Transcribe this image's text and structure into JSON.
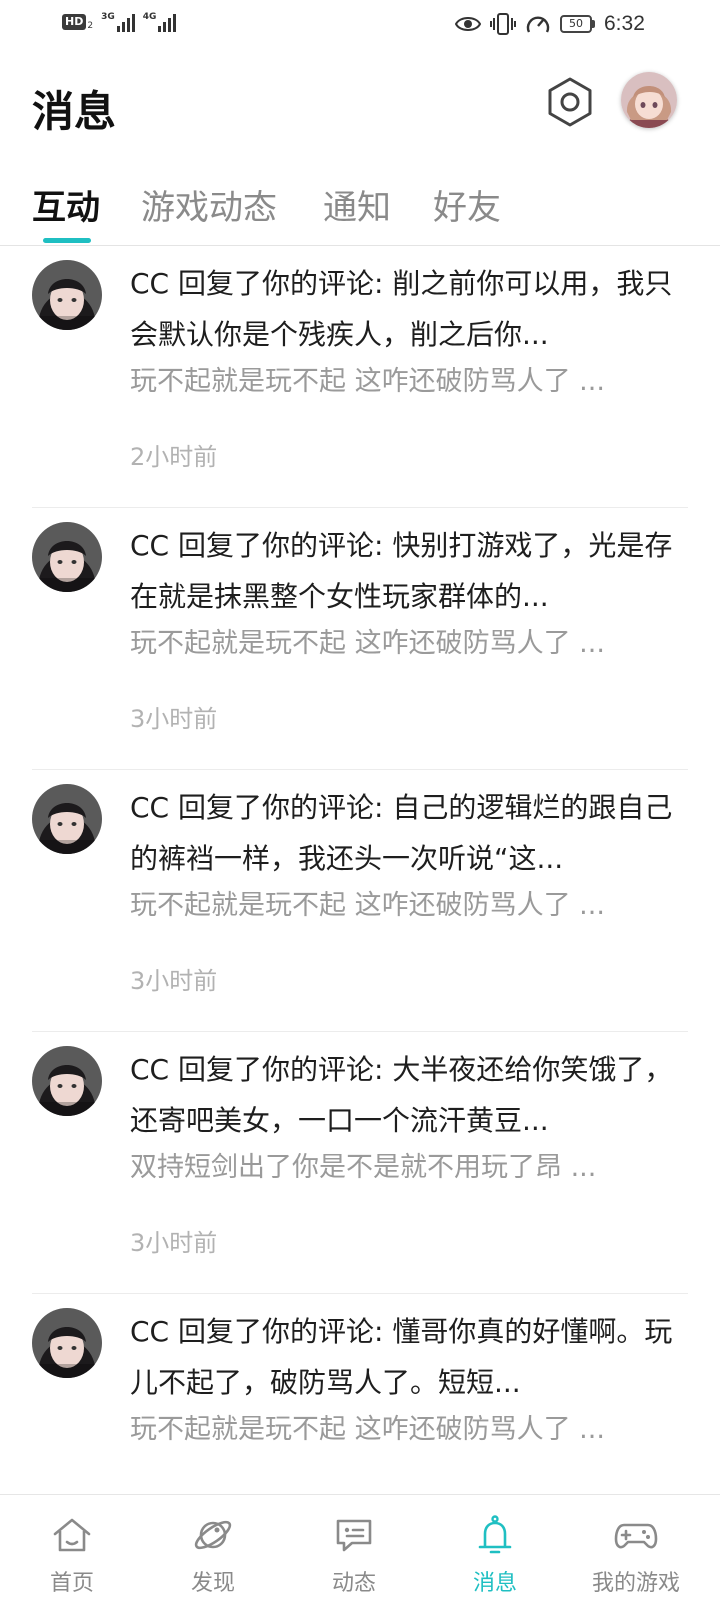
{
  "status_bar": {
    "hd_label": "HD",
    "hd_sub": "2",
    "net1_label": "3G",
    "net2_label": "4G",
    "battery_level": "50",
    "time": "6:32"
  },
  "header": {
    "title": "消息",
    "settings_icon": "settings-hexagon-icon",
    "avatar_icon": "anime-girl-avatar"
  },
  "tabs": [
    {
      "label": "互动",
      "active": true
    },
    {
      "label": "游戏动态",
      "active": false
    },
    {
      "label": "通知",
      "active": false
    },
    {
      "label": "好友",
      "active": false
    }
  ],
  "messages": [
    {
      "reply": "CC 回复了你的评论: 削之前你可以用，我只会默认你是个残疾人，削之后你...",
      "quote": "玩不起就是玩不起 这咋还破防骂人了 ...",
      "time_ago": "2小时前"
    },
    {
      "reply": "CC 回复了你的评论: 快别打游戏了，光是存在就是抹黑整个女性玩家群体的...",
      "quote": "玩不起就是玩不起 这咋还破防骂人了 ...",
      "time_ago": "3小时前"
    },
    {
      "reply": "CC 回复了你的评论: 自己的逻辑烂的跟自己的裤裆一样，我还头一次听说“这...",
      "quote": "玩不起就是玩不起 这咋还破防骂人了 ...",
      "time_ago": "3小时前"
    },
    {
      "reply": "CC 回复了你的评论: 大半夜还给你笑饿了，还寄吧美女，一口一个流汗黄豆...",
      "quote": "双持短剑出了你是不是就不用玩了昂 ...",
      "time_ago": "3小时前"
    },
    {
      "reply": "CC 回复了你的评论: 懂哥你真的好懂啊。玩儿不起了，破防骂人了。短短...",
      "quote": "玩不起就是玩不起 这咋还破防骂人了 ...",
      "time_ago": ""
    }
  ],
  "bottom_nav": [
    {
      "label": "首页",
      "icon": "home-icon",
      "active": false
    },
    {
      "label": "发现",
      "icon": "planet-icon",
      "active": false
    },
    {
      "label": "动态",
      "icon": "chat-bubble-icon",
      "active": false
    },
    {
      "label": "消息",
      "icon": "bell-icon",
      "active": true
    },
    {
      "label": "我的游戏",
      "icon": "gamepad-icon",
      "active": false
    }
  ],
  "colors": {
    "accent": "#1fbfc2",
    "text_primary": "#1e1e1e",
    "text_secondary": "#9a9a9a"
  }
}
